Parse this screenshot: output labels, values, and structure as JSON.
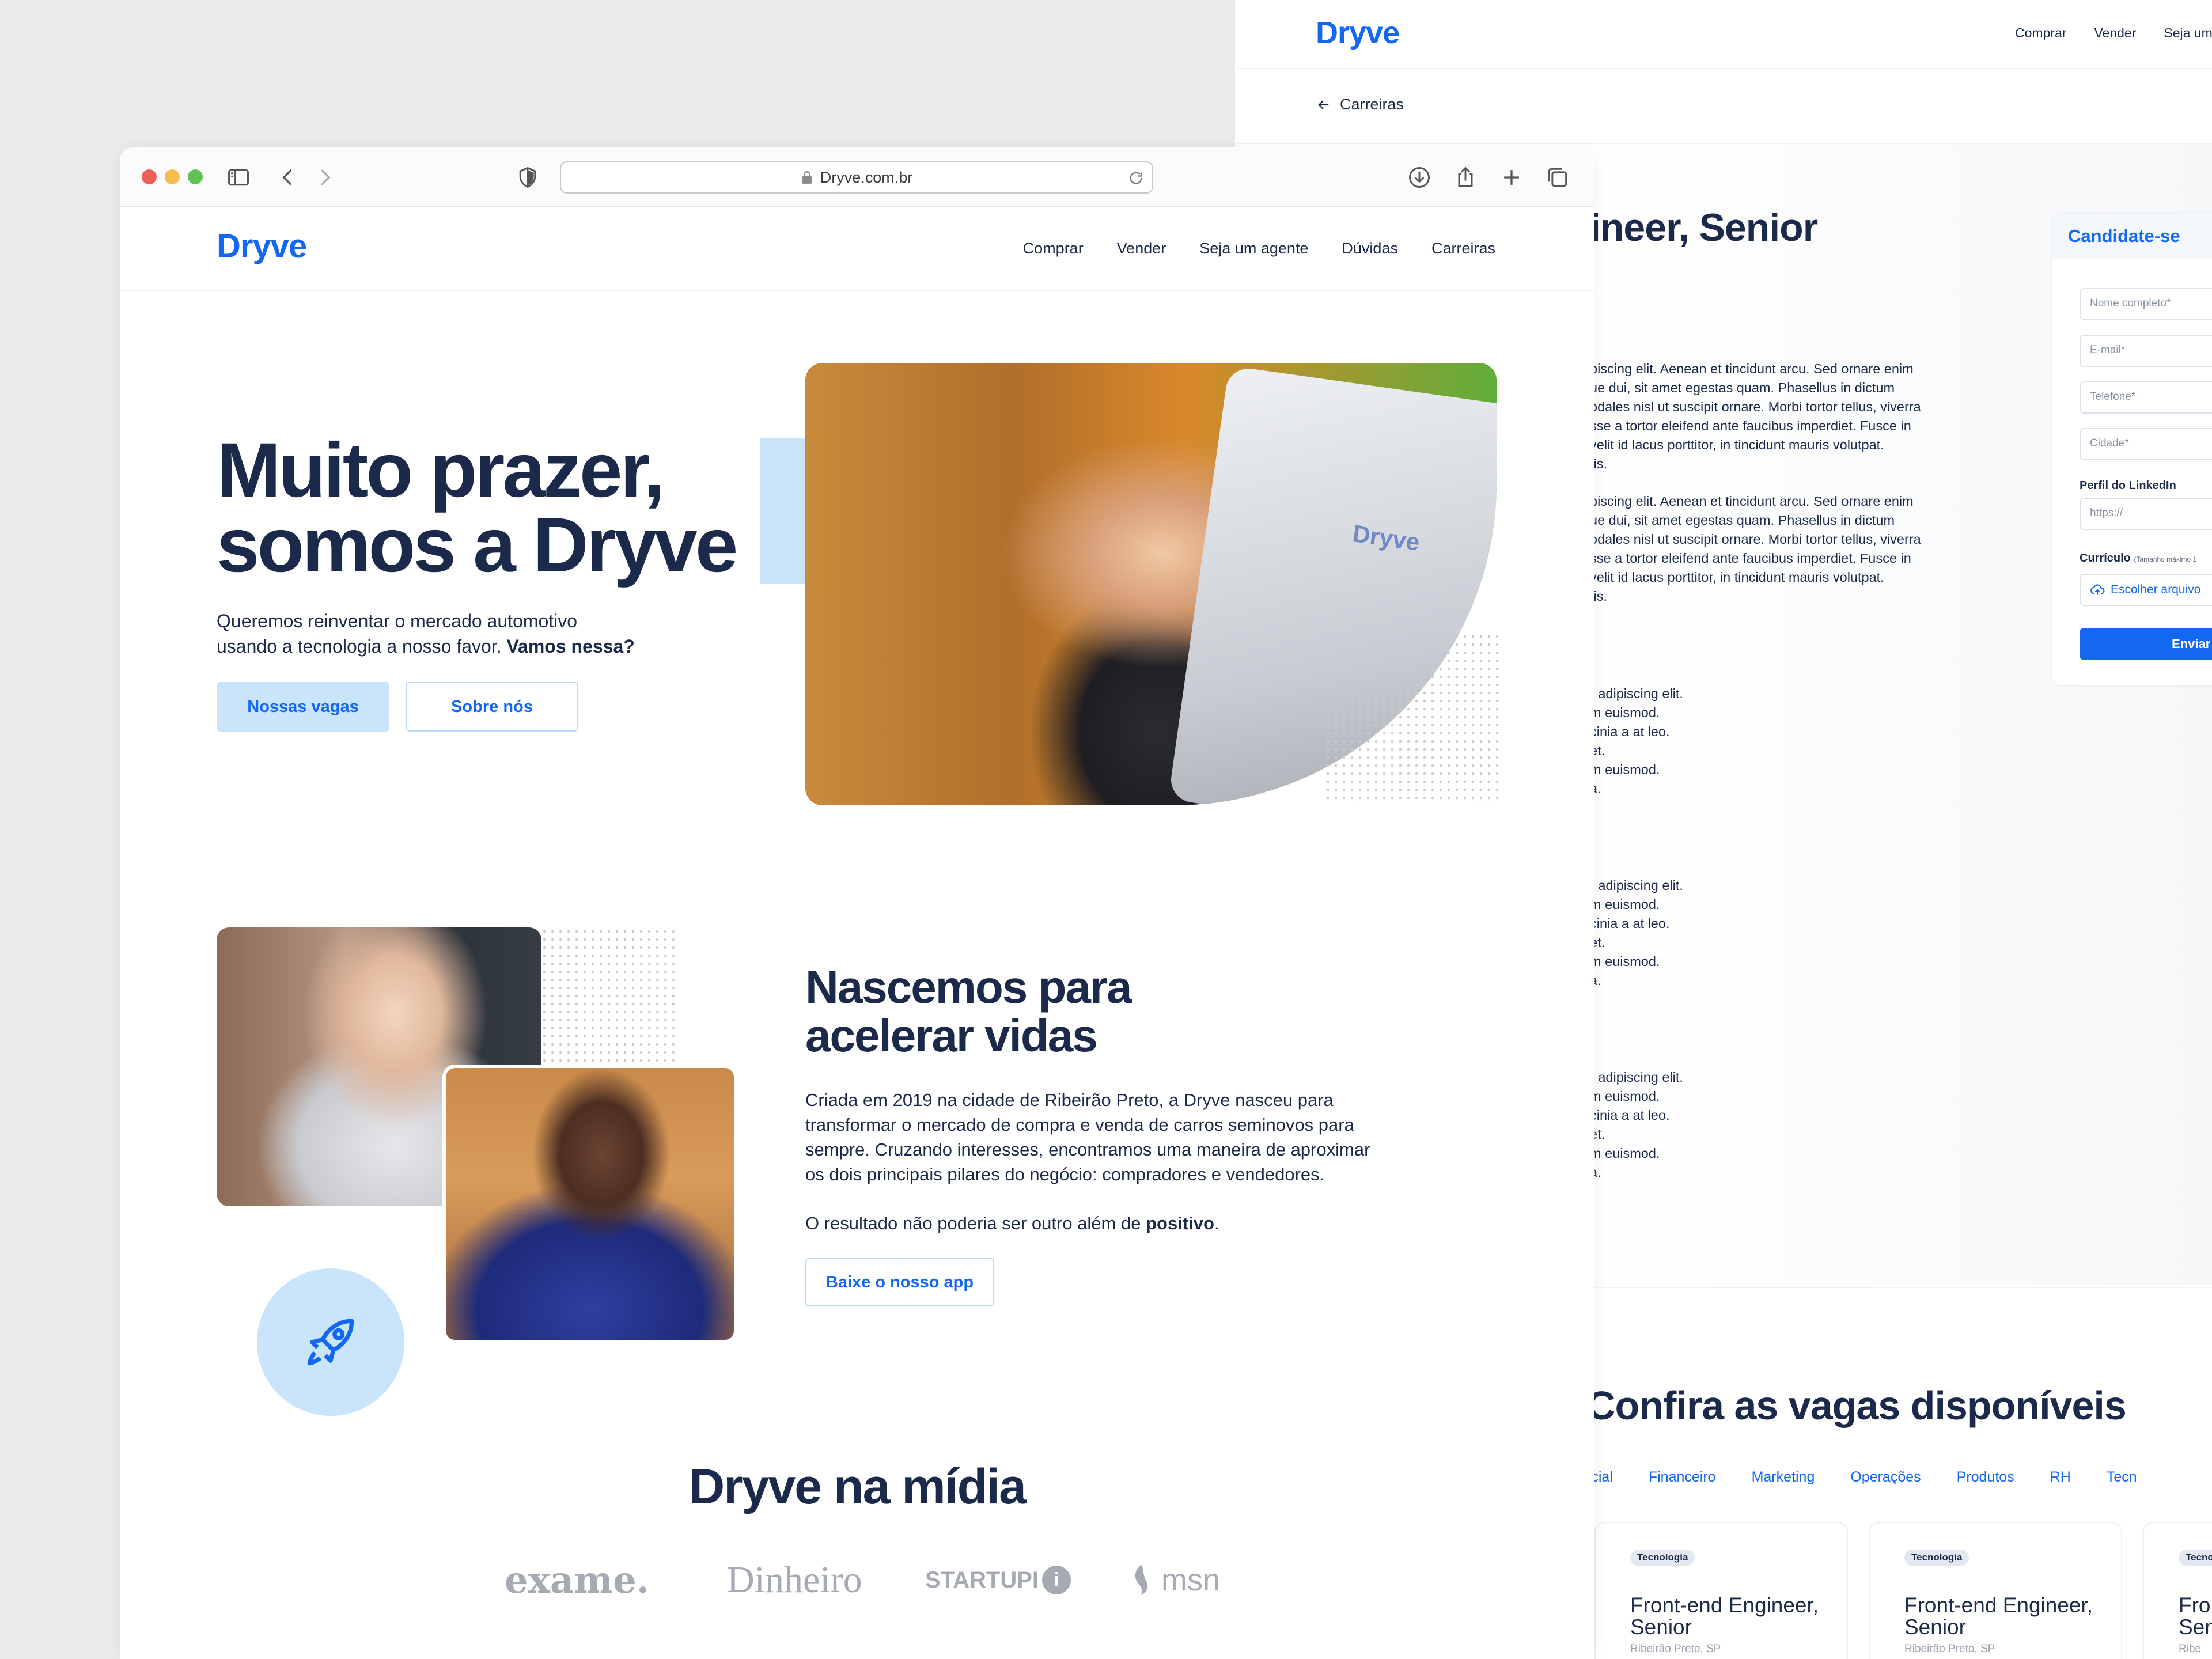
{
  "back_page": {
    "logo": "Dryve",
    "nav": [
      "Comprar",
      "Vender",
      "Seja um a"
    ],
    "breadcrumb": "Carreiras",
    "job_title": "ineer, Senior",
    "desc_paragraphs": [
      [
        "piscing elit. Aenean et tincidunt arcu. Sed ornare enim",
        "ue dui, sit amet egestas quam. Phasellus in dictum",
        "odales nisl ut suscipit ornare. Morbi tortor tellus, viverra",
        "sse a tortor eleifend ante faucibus imperdiet. Fusce in",
        " velit id lacus porttitor, in tincidunt mauris volutpat.",
        "tis."
      ],
      [
        "piscing elit. Aenean et tincidunt arcu. Sed ornare enim",
        "ue dui, sit amet egestas quam. Phasellus in dictum",
        "odales nisl ut suscipit ornare. Morbi tortor tellus, viverra",
        "sse a tortor eleifend ante faucibus imperdiet. Fusce in",
        " velit id lacus porttitor, in tincidunt mauris volutpat.",
        "tis."
      ]
    ],
    "short_lists": [
      [
        "r adipiscing elit.",
        "m euismod.",
        "cinia a at leo.",
        "et.",
        "m euismod.",
        "a."
      ],
      [
        "r adipiscing elit.",
        "m euismod.",
        "cinia a at leo.",
        "et.",
        "m euismod.",
        "a."
      ],
      [
        "r adipiscing elit.",
        "m euismod.",
        "cinia a at leo.",
        "et.",
        "m euismod.",
        "a."
      ]
    ],
    "apply": {
      "title": "Candidate-se",
      "fields": [
        "Nome completo*",
        "E-mail*",
        "Telefone*",
        "Cidade*"
      ],
      "linkedin_label": "Perfil do LinkedIn",
      "linkedin_placeholder": "https://",
      "cv_label": "Currículo",
      "cv_note": "(Tamanho máximo 1",
      "file_button": "Escolher arquivo",
      "submit": "Enviar c"
    },
    "jobs_title": "Confira as vagas disponíveis",
    "jobs_tabs": [
      "rcial",
      "Financeiro",
      "Marketing",
      "Operações",
      "Produtos",
      "RH",
      "Tecn"
    ],
    "job_cards": [
      {
        "tag": "Tecnologia",
        "name_l1": "Front-end Engineer,",
        "name_l2": "Senior",
        "location": "Ribeirão Preto, SP"
      },
      {
        "tag": "Tecnologia",
        "name_l1": "Front-end Engineer,",
        "name_l2": "Senior",
        "location": "Ribeirão Preto, SP"
      },
      {
        "tag": "Tecnolo",
        "name_l1": "Fron",
        "name_l2": "Seni",
        "location": "Ribe"
      }
    ]
  },
  "browser": {
    "url": "Dryve.com.br",
    "traffic_colors": [
      "#ee5f57",
      "#f4bd4f",
      "#5fc454"
    ]
  },
  "site": {
    "logo": "Dryve",
    "nav": [
      "Comprar",
      "Vender",
      "Seja um agente",
      "Dúvidas",
      "Carreiras"
    ],
    "hero": {
      "title_l1": "Muito prazer,",
      "title_l2": "somos a Dryve",
      "sub_l1": "Queremos reinventar o mercado automotivo",
      "sub_l2": "usando a tecnologia a nosso favor.",
      "sub_bold": "Vamos nessa?",
      "btn_primary": "Nossas vagas",
      "btn_secondary": "Sobre nós",
      "photo_logo": "Dryve"
    },
    "about": {
      "title_l1": "Nascemos para",
      "title_l2": "acelerar vidas",
      "text": [
        "Criada em 2019 na cidade de Ribeirão Preto, a Dryve nasceu para",
        "transformar o mercado de compra e venda de carros seminovos para",
        "sempre. Cruzando interesses, encontramos uma maneira de aproximar",
        "os dois principais pilares do negócio: compradores e vendedores."
      ],
      "result_text": "O resultado não poderia ser outro além de",
      "result_bold": "positivo",
      "result_end": ".",
      "btn_app": "Baixe o nosso app"
    },
    "media": {
      "title": "Dryve na mídia",
      "logos": [
        "exame.",
        "Dinheiro",
        "STARTUPI",
        "msn"
      ]
    }
  }
}
